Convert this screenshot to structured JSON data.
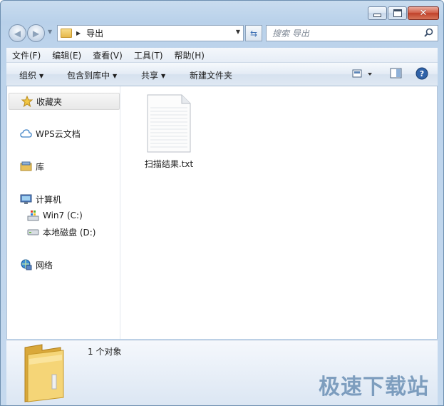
{
  "window": {
    "caption_buttons": {
      "minimize": "",
      "maximize": "",
      "close": "✕"
    }
  },
  "address_bar": {
    "path": "导出",
    "search_placeholder": "搜索 导出"
  },
  "menu": {
    "items": [
      "文件(F)",
      "编辑(E)",
      "查看(V)",
      "工具(T)",
      "帮助(H)"
    ]
  },
  "toolbar": {
    "organize": "组织",
    "include_in_library": "包含到库中",
    "share": "共享",
    "new_folder": "新建文件夹"
  },
  "navigation": {
    "favorites": "收藏夹",
    "wps_cloud": "WPS云文档",
    "libraries": "库",
    "computer": "计算机",
    "drive_c": "Win7 (C:)",
    "drive_d": "本地磁盘 (D:)",
    "network": "网络"
  },
  "files": [
    {
      "name": "扫描结果.txt",
      "icon": "text-file-icon"
    }
  ],
  "details": {
    "item_count": "1 个对象"
  },
  "watermark": "极速下载站",
  "colors": {
    "frame": "#bcd3eb",
    "close_button": "#c0412a",
    "accent": "#3c6fb3"
  }
}
